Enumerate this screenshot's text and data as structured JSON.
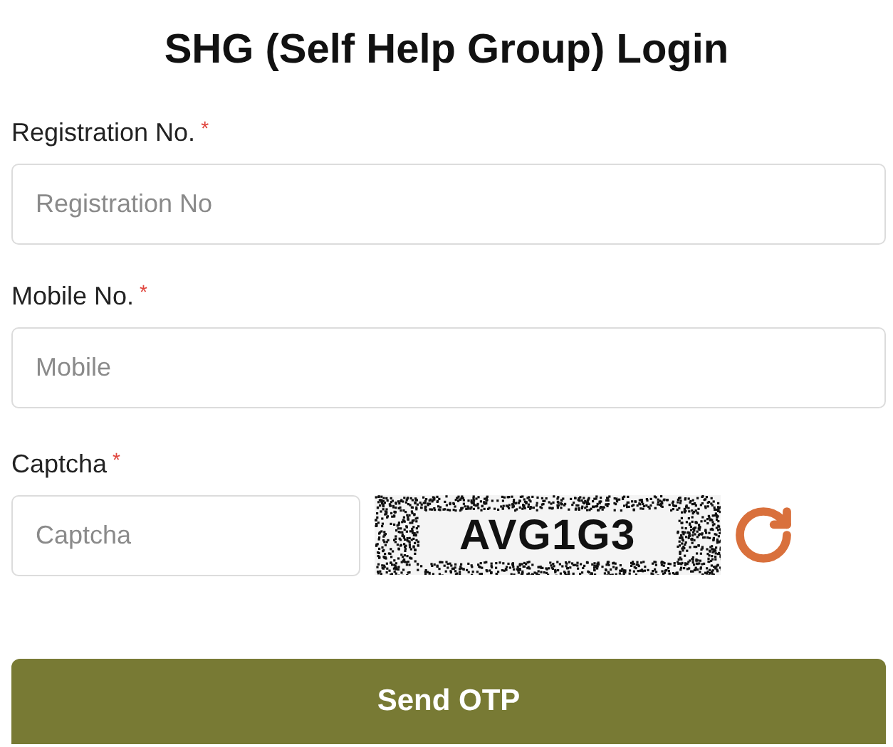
{
  "title": "SHG (Self Help Group) Login",
  "fields": [
    {
      "label": "Registration No.",
      "required_mark": "*",
      "placeholder": "Registration No"
    },
    {
      "label": "Mobile No.",
      "required_mark": "*",
      "placeholder": "Mobile"
    }
  ],
  "captcha": {
    "label": "Captcha",
    "required_mark": "*",
    "placeholder": "Captcha",
    "code": "AVG1G3"
  },
  "submit": "Send OTP"
}
